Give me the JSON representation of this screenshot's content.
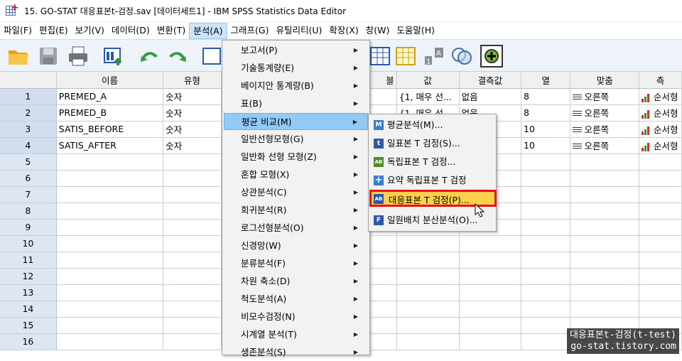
{
  "window": {
    "title": "15. GO-STAT 대응표본t-검정.sav [데이터세트1] - IBM SPSS Statistics Data Editor"
  },
  "menubar": [
    {
      "label": "파일(F)"
    },
    {
      "label": "편집(E)"
    },
    {
      "label": "보기(V)"
    },
    {
      "label": "데이터(D)"
    },
    {
      "label": "변환(T)"
    },
    {
      "label": "분석(A)"
    },
    {
      "label": "그래프(G)"
    },
    {
      "label": "유틸리티(U)"
    },
    {
      "label": "확장(X)"
    },
    {
      "label": "창(W)"
    },
    {
      "label": "도움말(H)"
    }
  ],
  "grid": {
    "columns": [
      "",
      "이름",
      "유형",
      "",
      "값",
      "결측값",
      "열",
      "맞춤",
      "측"
    ],
    "hidden_header_fragment": "블",
    "rows": [
      {
        "num": "1",
        "name": "PREMED_A",
        "type": "숫자",
        "values": "{1, 매우 선...",
        "missing": "없음",
        "columns": "8",
        "align": "오른쪽",
        "measure": "순서형"
      },
      {
        "num": "2",
        "name": "PREMED_B",
        "type": "숫자",
        "values": "{1, 매우 선...",
        "missing": "없음",
        "columns": "8",
        "align": "오른쪽",
        "measure": "순서형"
      },
      {
        "num": "3",
        "name": "SATIS_BEFORE",
        "type": "숫자",
        "values": "",
        "missing": "",
        "columns": "10",
        "align": "오른쪽",
        "measure": "순서형"
      },
      {
        "num": "4",
        "name": "SATIS_AFTER",
        "type": "숫자",
        "values": "",
        "missing": "",
        "columns": "10",
        "align": "오른쪽",
        "measure": "순서형"
      }
    ],
    "empty_rows": [
      "5",
      "6",
      "7",
      "8",
      "9",
      "10",
      "11",
      "12",
      "13",
      "14",
      "15",
      "16"
    ]
  },
  "analyze_menu": {
    "items": [
      {
        "label": "보고서(P)"
      },
      {
        "label": "기술통계량(E)"
      },
      {
        "label": "베이지안 통계량(B)"
      },
      {
        "label": "표(B)"
      },
      {
        "label": "평균 비교(M)"
      },
      {
        "label": "일반선형모형(G)"
      },
      {
        "label": "일반화 선형 모형(Z)"
      },
      {
        "label": "혼합 모형(X)"
      },
      {
        "label": "상관분석(C)"
      },
      {
        "label": "회귀분석(R)"
      },
      {
        "label": "로그선형분석(O)"
      },
      {
        "label": "신경망(W)"
      },
      {
        "label": "분류분석(F)"
      },
      {
        "label": "차원 축소(D)"
      },
      {
        "label": "척도분석(A)"
      },
      {
        "label": "비모수검정(N)"
      },
      {
        "label": "시계열 분석(T)"
      },
      {
        "label": "생존분석(S)"
      }
    ],
    "highlighted_index": 4
  },
  "compare_means_submenu": {
    "items": [
      {
        "label": "평균분석(M)...",
        "icon": "M"
      },
      {
        "label": "일표본 T 검정(S)...",
        "icon": "t"
      },
      {
        "label": "독립표본 T 검정...",
        "icon": "AB"
      },
      {
        "label": "요약 독립표본 T 검정",
        "icon": "+"
      },
      {
        "label": "대응표본 T 검정(P)...",
        "icon": "AB"
      },
      {
        "label": "일원배치 분산분석(O)...",
        "icon": "F"
      }
    ],
    "selected_index": 4
  },
  "watermark": {
    "line1": "대응표본t-검정(t-test)",
    "line2": "go-stat.tistory.com"
  },
  "colors": {
    "toolbar_bg": "#eef3fa",
    "menu_highlight": "#91c9f7",
    "selected_item_bg": "#fcd04a",
    "selected_item_border": "#e8101a",
    "rownum_bg": "#dde7f3"
  }
}
